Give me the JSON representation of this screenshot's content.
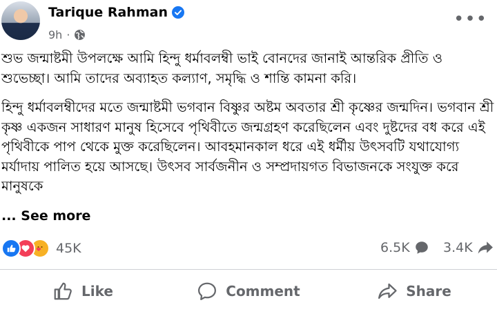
{
  "post": {
    "author": "Tarique Rahman",
    "time": "9h",
    "paragraph_1": "শুভ জন্মাষ্টমী উপলক্ষে আমি হিন্দু ধর্মাবলম্বী ভাই বোনদের জানাই আন্তরিক প্রীতি ও শুভেচ্ছা। আমি তাদের অব্যাহত কল্যাণ, সমৃদ্ধি ও শান্তি কামনা করি।",
    "paragraph_2": "হিন্দু ধর্মাবলম্বীদের মতে জন্মাষ্টমী ভগবান বিষ্ণুর অষ্টম অবতার শ্রী কৃষ্ণের জন্মদিন। ভগবান শ্রী কৃষ্ণ একজন সাধারণ মানুষ হিসেবে পৃথিবীতে জন্মগ্রহণ করেছিলেন এবং দুষ্টদের বধ করে এই পৃথিবীকে পাপ থেকে মুক্ত করেছিলেন। আবহমানকাল ধরে এই ধর্মীয় উৎসবটি যথাযোগ্য মর্যাদায় পালিত হয়ে আসছে। উৎসব সার্বজনীন ও সম্প্রদায়গত বিভাজনকে সংযুক্ত করে মানুষকে",
    "see_more": "... See more"
  },
  "stats": {
    "reactions_count": "45K",
    "comments_count": "6.5K",
    "shares_count": "3.4K"
  },
  "actions": {
    "like": "Like",
    "comment": "Comment",
    "share": "Share"
  },
  "icons": [
    "verified-badge-icon",
    "globe-icon",
    "more-options-icon",
    "like-reaction-icon",
    "love-reaction-icon",
    "care-reaction-icon",
    "comment-bubble-icon",
    "share-arrow-icon",
    "thumbs-up-icon"
  ],
  "colors": {
    "accent": "#1877f2",
    "love": "#f33e58",
    "care": "#f7b125",
    "secondary_text": "#65676b"
  }
}
